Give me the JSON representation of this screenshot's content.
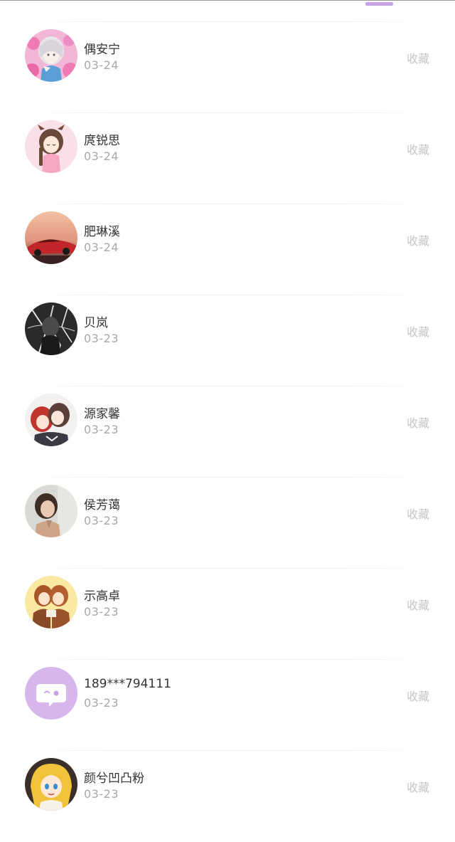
{
  "colors": {
    "accent": "#c7a4e8",
    "name_text": "#333333",
    "date_text": "#a8a8a8",
    "action_text": "#c6c6c6"
  },
  "action_label": "收藏",
  "items": [
    {
      "name": "偶安宁",
      "date": "03-24",
      "avatar": "anime-girl-pink-avatar",
      "action": "收藏"
    },
    {
      "name": "庹锐思",
      "date": "03-24",
      "avatar": "anime-girl-braids-avatar",
      "action": "收藏"
    },
    {
      "name": "肥琳溪",
      "date": "03-24",
      "avatar": "red-car-sunset-avatar",
      "action": "收藏"
    },
    {
      "name": "贝岚",
      "date": "03-23",
      "avatar": "dark-sketch-avatar",
      "action": "收藏"
    },
    {
      "name": "源家馨",
      "date": "03-23",
      "avatar": "anime-couple-avatar",
      "action": "收藏"
    },
    {
      "name": "侯芳蔼",
      "date": "03-23",
      "avatar": "woman-portrait-avatar",
      "action": "收藏"
    },
    {
      "name": "示高卓",
      "date": "03-23",
      "avatar": "anime-twins-avatar",
      "action": "收藏"
    },
    {
      "name": "189***794111",
      "date": "03-23",
      "avatar": "default-chat-bubble-avatar",
      "action": "收藏"
    },
    {
      "name": "颜兮凹凸粉",
      "date": "03-23",
      "avatar": "anime-blonde-girl-avatar",
      "action": "收藏"
    }
  ]
}
